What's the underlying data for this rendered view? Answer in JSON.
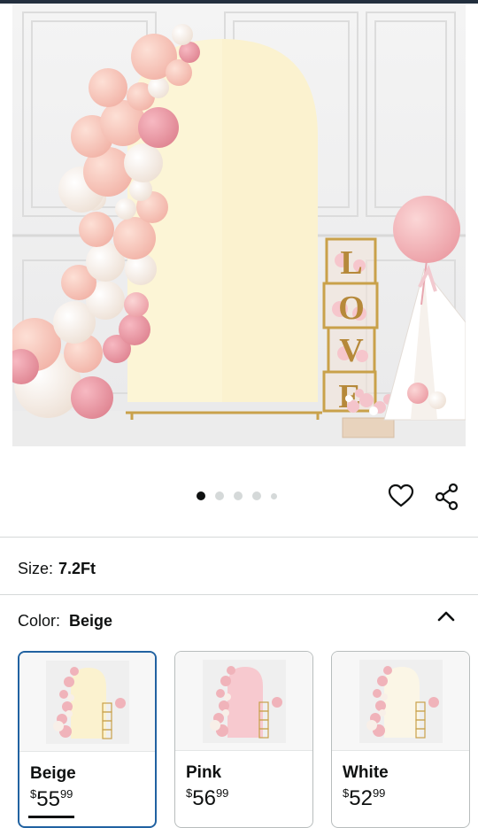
{
  "product_image": {
    "alt_icon": "product-photo"
  },
  "carousel": {
    "count": 5,
    "active_index": 0
  },
  "actions": {
    "favorite_icon": "heart-icon",
    "share_icon": "share-icon"
  },
  "size": {
    "label": "Size:",
    "value": "7.2Ft"
  },
  "color": {
    "label": "Color:",
    "value": "Beige",
    "toggle_icon": "chevron-up-icon"
  },
  "variants": [
    {
      "name": "Beige",
      "currency": "$",
      "dollars": "55",
      "cents": "99",
      "swatch": "#fbf2cf"
    },
    {
      "name": "Pink",
      "currency": "$",
      "dollars": "56",
      "cents": "99",
      "swatch": "#f7c9cf"
    },
    {
      "name": "White",
      "currency": "$",
      "dollars": "52",
      "cents": "99",
      "swatch": "#fbf6e6"
    }
  ],
  "colors": {
    "selected_border": "#2162a1",
    "text": "#0f1111"
  }
}
